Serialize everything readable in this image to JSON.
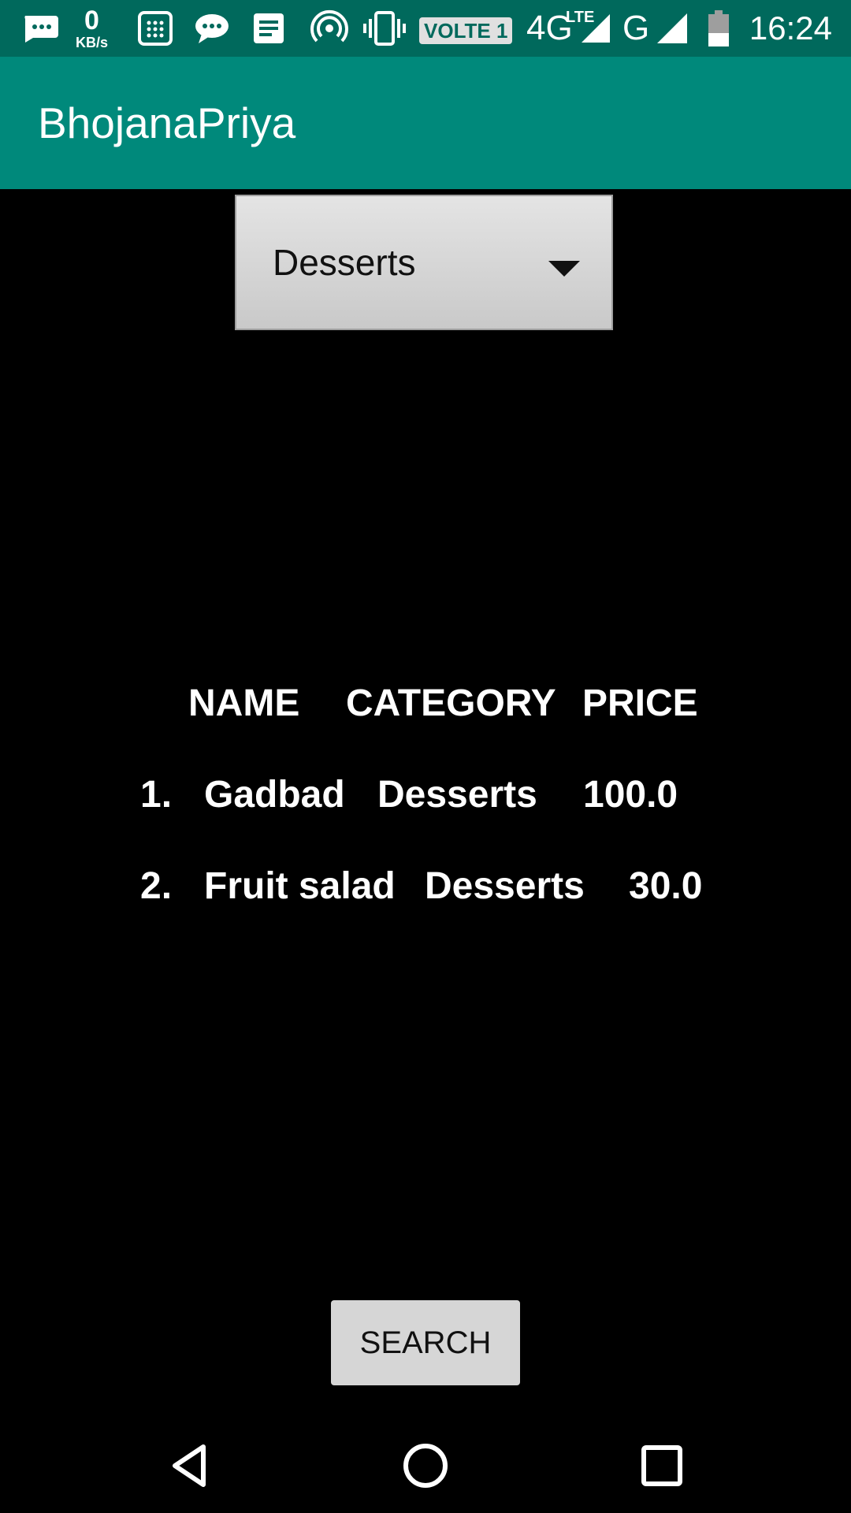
{
  "status_bar": {
    "net_speed_value": "0",
    "net_speed_unit": "KB/s",
    "volte": "VOLTE 1",
    "network_4g": "4G",
    "lte": "LTE",
    "network_g": "G",
    "time": "16:24"
  },
  "app_bar": {
    "title": "BhojanaPriya"
  },
  "category_spinner": {
    "selected": "Desserts"
  },
  "table": {
    "headers": {
      "name": "NAME",
      "category": "CATEGORY",
      "price": "PRICE"
    },
    "rows": [
      {
        "index": "1.",
        "name": "Gadbad",
        "category": "Desserts",
        "price": "100.0"
      },
      {
        "index": "2.",
        "name": "Fruit salad",
        "category": "Desserts",
        "price": "30.0"
      }
    ]
  },
  "search_button": {
    "label": "SEARCH"
  },
  "icons": {
    "status": [
      "message-bubble-icon",
      "calculator-icon",
      "chat-icon",
      "notes-icon",
      "hotspot-icon",
      "vibrate-icon",
      "signal-icon",
      "battery-icon"
    ],
    "nav": [
      "back-icon",
      "home-icon",
      "recents-icon"
    ]
  },
  "colors": {
    "status_bar": "#00695c",
    "app_bar": "#00897b",
    "background": "#000000",
    "button": "#d6d6d6"
  }
}
